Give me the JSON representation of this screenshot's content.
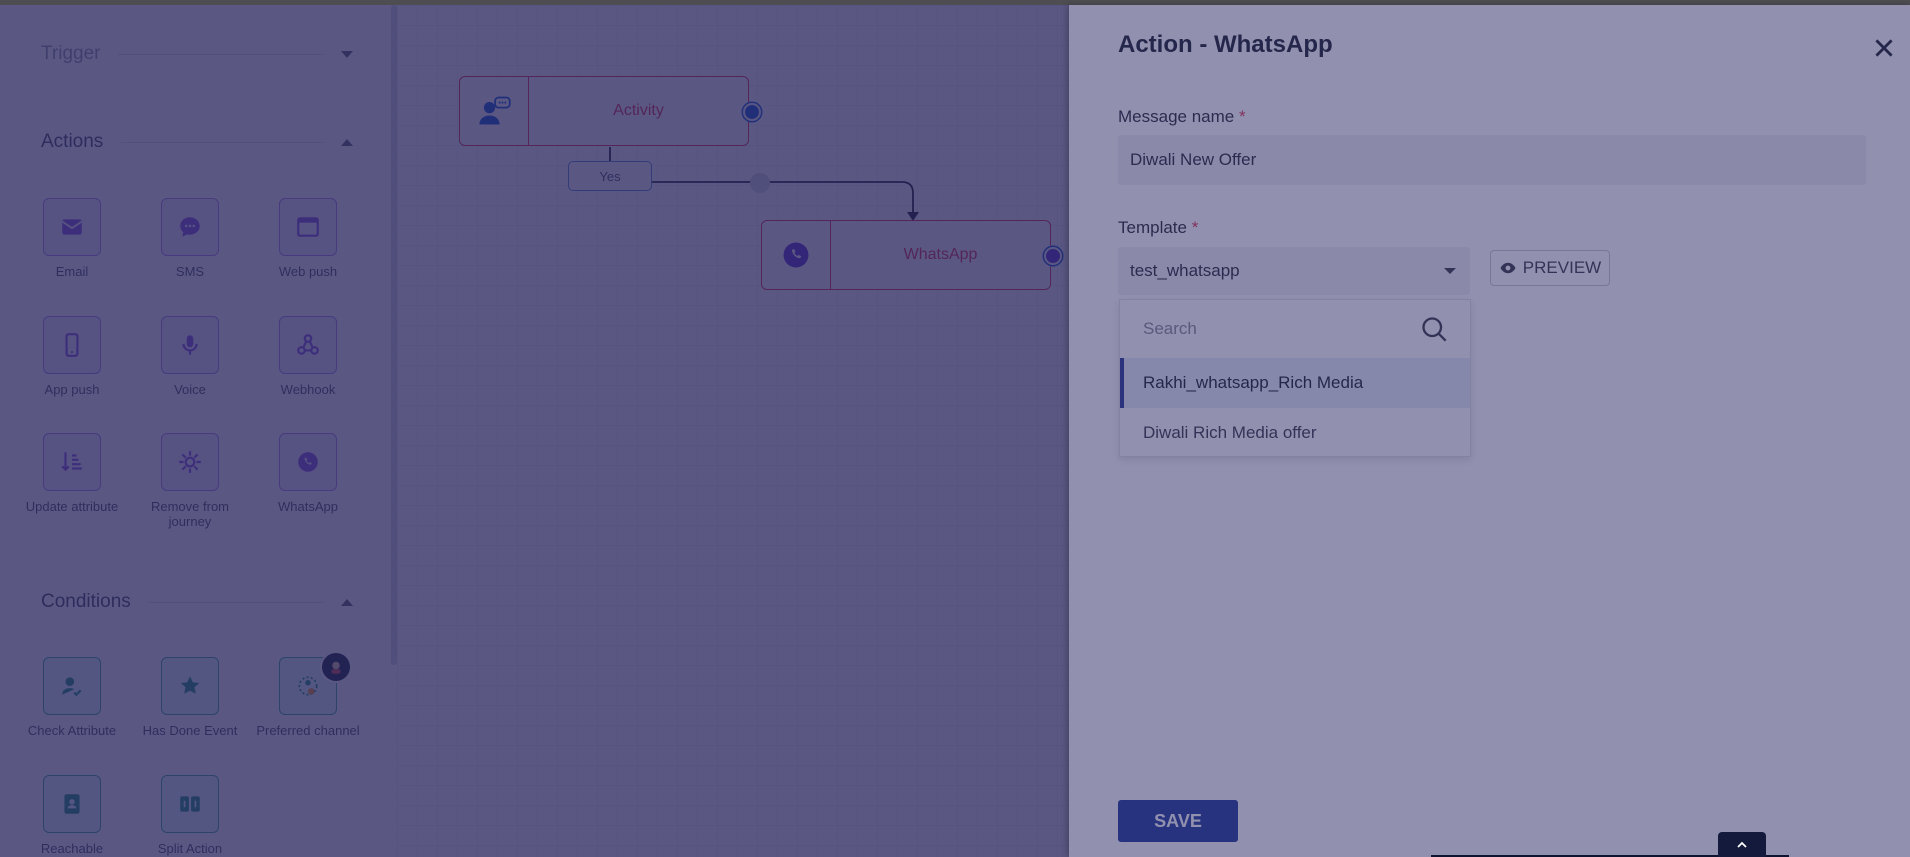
{
  "sidebar": {
    "trigger": {
      "title": "Trigger"
    },
    "actions": {
      "title": "Actions",
      "items": [
        {
          "label": "Email",
          "icon": "email-icon"
        },
        {
          "label": "SMS",
          "icon": "sms-icon"
        },
        {
          "label": "Web push",
          "icon": "web-push-icon"
        },
        {
          "label": "App push",
          "icon": "app-push-icon"
        },
        {
          "label": "Voice",
          "icon": "voice-icon"
        },
        {
          "label": "Webhook",
          "icon": "webhook-icon"
        },
        {
          "label": "Update attribute",
          "icon": "update-attribute-icon"
        },
        {
          "label": "Remove from journey",
          "icon": "remove-from-journey-icon"
        },
        {
          "label": "WhatsApp",
          "icon": "whatsapp-icon"
        }
      ]
    },
    "conditions": {
      "title": "Conditions",
      "items": [
        {
          "label": "Check Attribute",
          "icon": "check-attribute-icon"
        },
        {
          "label": "Has Done Event",
          "icon": "has-done-event-icon"
        },
        {
          "label": "Preferred channel",
          "icon": "preferred-channel-icon"
        },
        {
          "label": "Reachable",
          "icon": "reachable-icon"
        },
        {
          "label": "Split Action",
          "icon": "split-action-icon"
        }
      ]
    }
  },
  "canvas": {
    "nodes": [
      {
        "label": "Activity",
        "icon": "activity-icon"
      },
      {
        "label": "WhatsApp",
        "icon": "whatsapp-icon"
      }
    ],
    "branch_label": "Yes"
  },
  "drawer": {
    "title": "Action - WhatsApp",
    "message_name": {
      "label": "Message name",
      "required_mark": "*",
      "value": "Diwali New Offer"
    },
    "template": {
      "label": "Template",
      "required_mark": "*",
      "value": "test_whatsapp"
    },
    "preview_label": "PREVIEW",
    "dropdown": {
      "search_placeholder": "Search",
      "options": [
        {
          "label": "Rakhi_whatsapp_Rich Media",
          "selected": true
        },
        {
          "label": "Diwali Rich Media offer",
          "selected": false
        }
      ]
    },
    "save_label": "SAVE"
  },
  "colors": {
    "accent": "#243d9e",
    "node_border": "#e23c5a",
    "action_tile": "#b48cec",
    "condition_tile": "#4fb3a0",
    "overlay": "#201e58"
  }
}
